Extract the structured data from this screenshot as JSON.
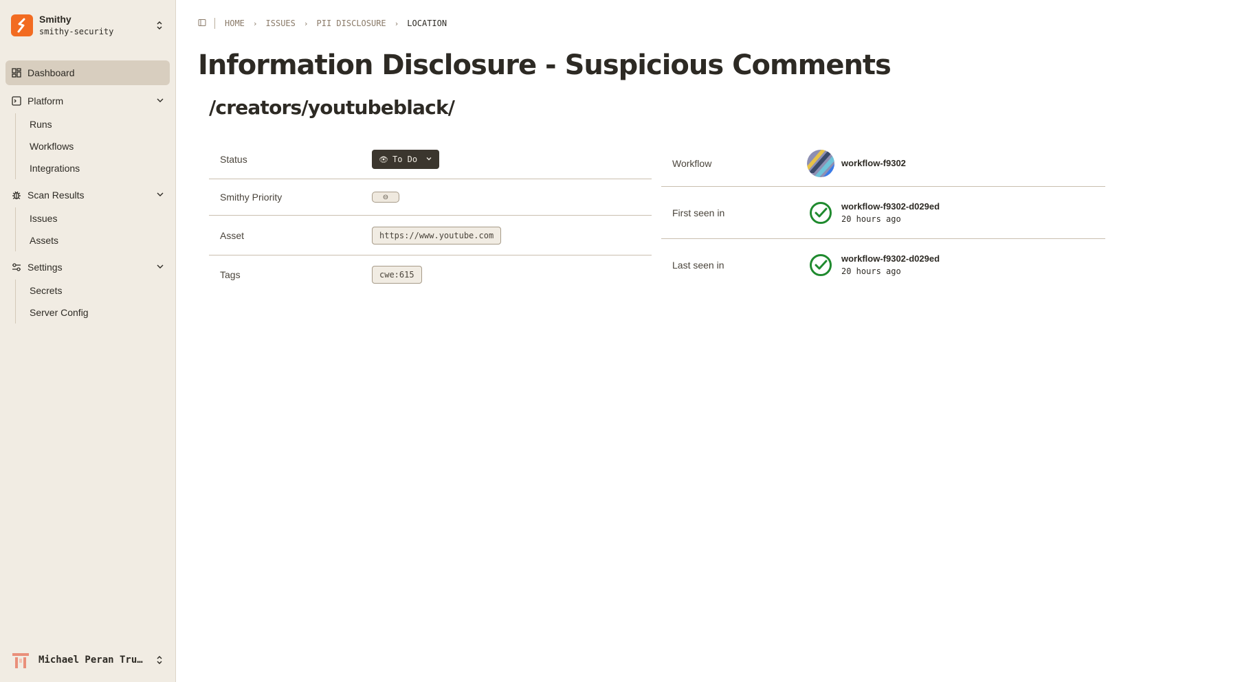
{
  "org": {
    "name": "Smithy",
    "slug": "smithy-security"
  },
  "nav": {
    "dashboard": "Dashboard",
    "platform": {
      "label": "Platform",
      "items": [
        "Runs",
        "Workflows",
        "Integrations"
      ]
    },
    "scan_results": {
      "label": "Scan Results",
      "items": [
        "Issues",
        "Assets"
      ]
    },
    "settings": {
      "label": "Settings",
      "items": [
        "Secrets",
        "Server Config"
      ]
    }
  },
  "user": {
    "name": "Michael Peran Tru…"
  },
  "breadcrumb": [
    "HOME",
    "ISSUES",
    "PII DISCLOSURE",
    "LOCATION"
  ],
  "page": {
    "title": "Information Disclosure - Suspicious Comments",
    "location": "/creators/youtubeblack/"
  },
  "details": {
    "status_label": "Status",
    "status_value": "To Do",
    "priority_label": "Smithy Priority",
    "priority_value": "⊖",
    "asset_label": "Asset",
    "asset_value": "https://www.youtube.com",
    "tags_label": "Tags",
    "tags_value": "cwe:615"
  },
  "run_info": {
    "workflow_label": "Workflow",
    "workflow_value": "workflow-f9302",
    "first_seen_label": "First seen in",
    "first_seen_workflow": "workflow-f9302-d029ed",
    "first_seen_time": "20 hours ago",
    "last_seen_label": "Last seen in",
    "last_seen_workflow": "workflow-f9302-d029ed",
    "last_seen_time": "20 hours ago"
  },
  "colors": {
    "accent": "#f26b21",
    "success": "#1f8a2e",
    "sidebar_bg": "#f1ece3",
    "active_bg": "#d8cebf"
  }
}
